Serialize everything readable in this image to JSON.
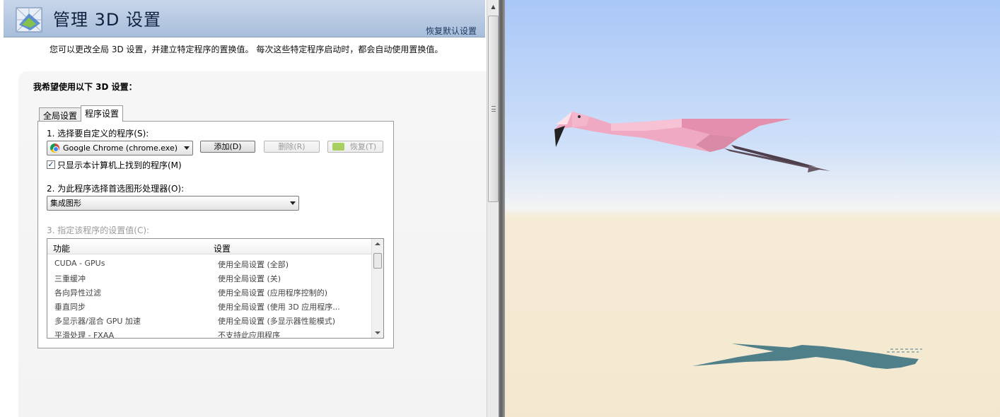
{
  "header": {
    "title": "管理 3D 设置",
    "restore_link": "恢复默认设置"
  },
  "intro": "您可以更改全局 3D 设置，并建立特定程序的置换值。 每次这些特定程序启动时，都会自动使用置换值。",
  "panel": {
    "heading": "我希望使用以下 3D 设置：",
    "tabs": [
      "全局设置",
      "程序设置"
    ],
    "step1_label": "1. 选择要自定义的程序(S):",
    "program_selected": "Google Chrome (chrome.exe)",
    "add_button": "添加(D)",
    "remove_button": "删除(R)",
    "restore_button": "恢复(T)",
    "show_only_checkbox": "只显示本计算机上找到的程序(M)",
    "show_only_checked": true,
    "step2_label": "2. 为此程序选择首选图形处理器(O):",
    "gpu_selected": "集成图形",
    "step3_label": "3. 指定该程序的设置值(C):",
    "list_headers": [
      "功能",
      "设置"
    ],
    "list_rows": [
      {
        "feature": "CUDA - GPUs",
        "setting": "使用全局设置 (全部)"
      },
      {
        "feature": "三重缓冲",
        "setting": "使用全局设置 (关)"
      },
      {
        "feature": "各向异性过滤",
        "setting": "使用全局设置 (应用程序控制的)"
      },
      {
        "feature": "垂直同步",
        "setting": "使用全局设置 (使用 3D 应用程序..."
      },
      {
        "feature": "多显示器/混合 GPU 加速",
        "setting": "使用全局设置 (多显示器性能模式)"
      },
      {
        "feature": "平滑处理 - FXAA",
        "setting": "不支持此应用程序"
      }
    ]
  },
  "viewport": {
    "sky_top": "#a9c7f7",
    "ground": "#f3e8cf",
    "bird_color": "#f0a7c0",
    "shadow_color": "#4f7f88"
  }
}
